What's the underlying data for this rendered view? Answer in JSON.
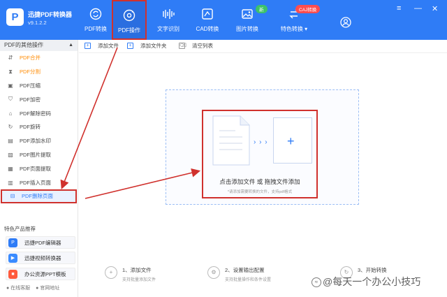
{
  "app": {
    "logo_letter": "P",
    "name": "迅捷PDF转换器",
    "version": "v9.1.2.2"
  },
  "nav": [
    {
      "label": "PDF转换",
      "icon": "refresh-circle-icon"
    },
    {
      "label": "PDF操作",
      "icon": "gear-circle-icon"
    },
    {
      "label": "文字识别",
      "icon": "ocr-wave-icon"
    },
    {
      "label": "CAD转换",
      "icon": "cad-icon"
    },
    {
      "label": "图片转换",
      "icon": "image-icon"
    },
    {
      "label": "特色转换",
      "icon": "special-convert-icon"
    }
  ],
  "badges": {
    "new": "新",
    "cad": "CAJ转换"
  },
  "window": {
    "menu": "≡",
    "minimize": "—",
    "close": "✕"
  },
  "sidebar": {
    "header": "PDF的其他操作",
    "items": [
      {
        "label": "PDF合并",
        "icon": "merge-icon"
      },
      {
        "label": "PDF分割",
        "icon": "split-icon"
      },
      {
        "label": "PDF压缩",
        "icon": "compress-icon"
      },
      {
        "label": "PDF加密",
        "icon": "lock-icon"
      },
      {
        "label": "PDF解除密码",
        "icon": "unlock-icon"
      },
      {
        "label": "PDF旋转",
        "icon": "rotate-icon"
      },
      {
        "label": "PDF添加水印",
        "icon": "watermark-icon"
      },
      {
        "label": "PDF图片提取",
        "icon": "image-extract-icon"
      },
      {
        "label": "PDF页面提取",
        "icon": "page-extract-icon"
      },
      {
        "label": "PDF插入页面",
        "icon": "insert-page-icon"
      },
      {
        "label": "PDF删除页面",
        "icon": "delete-page-icon"
      }
    ],
    "rec_header": "特色产品推荐",
    "recommend": [
      {
        "label": "迅捷PDF编辑器",
        "color": "#2f7cf6"
      },
      {
        "label": "迅捷视频转换器",
        "color": "#3a8bff"
      },
      {
        "label": "办公资源PPT模板",
        "color": "#ff5a3c"
      }
    ],
    "foot": [
      "● 在线客服",
      "● 官网地址"
    ]
  },
  "toolbar": {
    "add_file": "添加文件",
    "add_folder": "添加文件夹",
    "clear_list": "清空列表"
  },
  "drop": {
    "title": "点击添加文件 或 拖拽文件添加",
    "tip": "*请添加需要转换的文件，支持pdf格式",
    "chevrons": "› › ›",
    "plus": "+"
  },
  "steps": [
    {
      "num": "1",
      "title": "1、添加文件",
      "desc": "支持批量添加文件"
    },
    {
      "num": "2",
      "title": "2、设置输出配置",
      "desc": "支持批量操作和条件设置"
    },
    {
      "num": "3",
      "title": "3、开始转换",
      "desc": ""
    }
  ],
  "watermark": "@每天一个办公小技巧"
}
